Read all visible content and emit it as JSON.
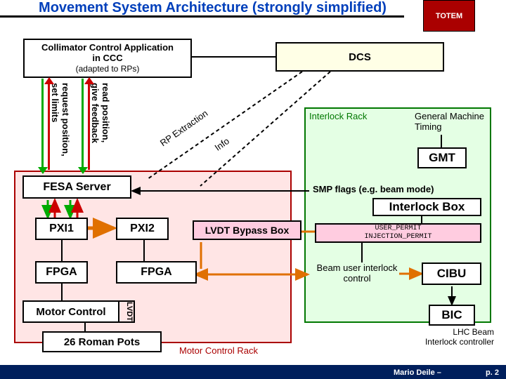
{
  "title": {
    "text": "Movement System Architecture (strongly simplified)"
  },
  "diagram": {
    "collimator": {
      "title": "Collimator Control Application",
      "line2": "in CCC",
      "sub": "(adapted to RPs)"
    },
    "dcs": "DCS",
    "vlabels": {
      "read": {
        "line1": "read position,",
        "line2": "give feedback"
      },
      "request": {
        "line1": "request position,",
        "line2": "set limits"
      }
    },
    "rp_extraction": "RP Extraction",
    "info": "Info",
    "fesa": "FESA Server",
    "pxi1": "PXI1",
    "pxi2": "PXI2",
    "fpga": "FPGA",
    "motor_control": "Motor Control",
    "lvdt": "LVDT",
    "roman_pots": "26 Roman Pots",
    "motor_rack_label": "Motor Control Rack",
    "interlock_rack_label": "Interlock Rack",
    "general_timing": "General Machine Timing",
    "gmt": "GMT",
    "smp": "SMP flags (e.g. beam mode)",
    "interlock_box": "Interlock Box",
    "permits": {
      "line1": "USER_PERMIT",
      "line2": "INJECTION_PERMIT"
    },
    "lvdt_bypass": "LVDT Bypass Box",
    "beam_user": "Beam user interlock control",
    "cibu": "CIBU",
    "bic": "BIC",
    "lhc_beam": {
      "line1": "LHC Beam",
      "line2": "Interlock controller"
    }
  },
  "footer": {
    "author": "Mario Deile",
    "page": "p. 2"
  }
}
